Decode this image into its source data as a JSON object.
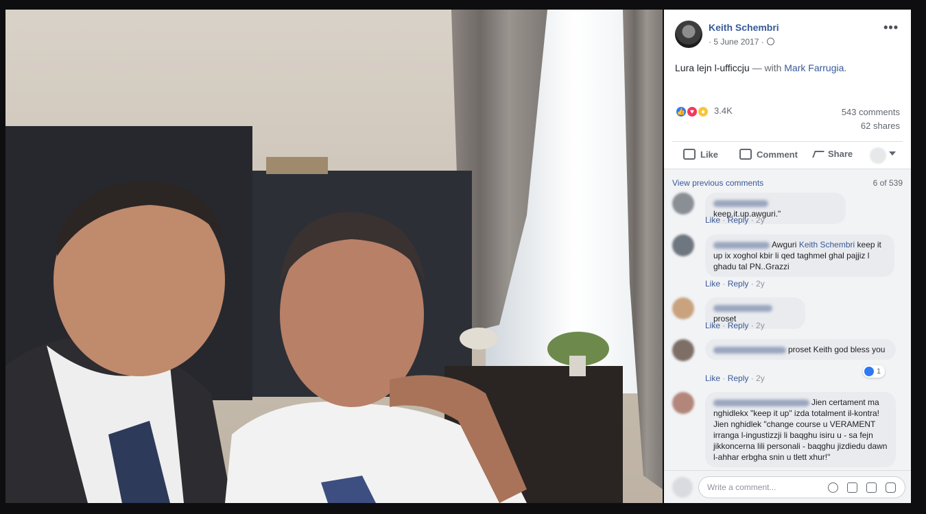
{
  "post": {
    "author": "Keith Schembri",
    "date": "5 June 2017",
    "privacy_icon": "globe-icon",
    "more_icon": "•••",
    "caption": {
      "text": "Lura lejn l-ufficcju",
      "with_prefix": "— with",
      "tagged": "Mark Farrugia",
      "suffix": "."
    },
    "reactions": {
      "types": [
        "like",
        "love",
        "wow"
      ],
      "count": "3.4K",
      "colors": {
        "like": "#2f78f5",
        "love": "#f2385c",
        "wow": "#f7c739"
      }
    },
    "comments_count": "543 comments",
    "shares_count": "62 shares"
  },
  "actions": {
    "like": "Like",
    "comment": "Comment",
    "share": "Share"
  },
  "comments_section": {
    "view_previous": "View previous comments",
    "position": "6 of 539",
    "comments": [
      {
        "text": "keep.it.up.awguri.\"",
        "like": "Like",
        "reply": "Reply",
        "age": "2y"
      },
      {
        "text_before": "Awguri",
        "mention": "Keith Schembri",
        "text_after": "keep it up ix xoghol kbir li qed taghmel ghal pajjiz l ghadu tal PN..Grazzi",
        "like": "Like",
        "reply": "Reply",
        "age": "2y"
      },
      {
        "text": "proset",
        "like": "Like",
        "reply": "Reply",
        "age": "2y"
      },
      {
        "text": "proset Keith god bless you",
        "like": "Like",
        "reply": "Reply",
        "age": "2y",
        "reaction_count": "1"
      },
      {
        "text": "Jien certament ma nghidlekx \"keep it up\" izda totalment il-kontra! Jien nghidlek \"change course u VERAMENT irranga l-ingustizzji li baqghu isiru u - sa fejn jikkoncerna lili personali - baqghu jizdiedu dawn l-ahhar erbgha snin u tlett xhur!\""
      }
    ]
  },
  "composer": {
    "placeholder": "Write a comment..."
  }
}
